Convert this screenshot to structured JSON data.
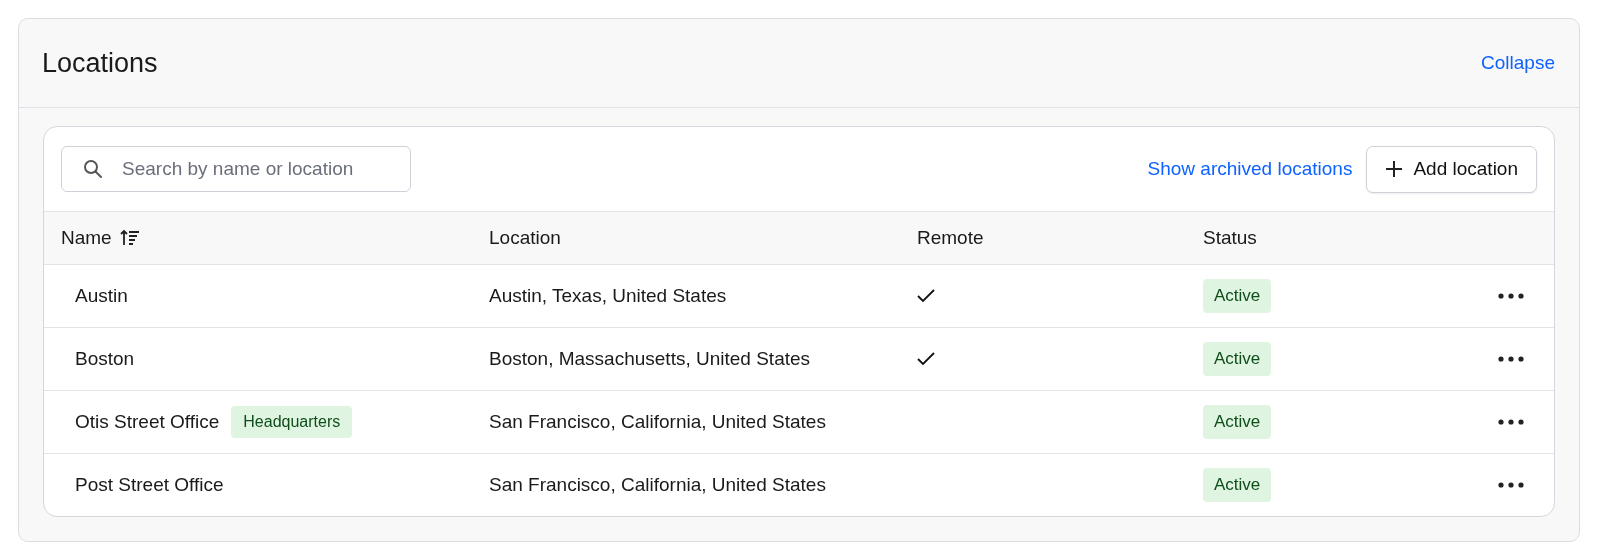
{
  "panel": {
    "title": "Locations",
    "collapse_link": "Collapse"
  },
  "toolbar": {
    "search": {
      "placeholder": "Search by name or location"
    },
    "archived_link": "Show archived locations",
    "add_button": "Add location"
  },
  "table": {
    "columns": [
      "Name",
      "Location",
      "Remote",
      "Status"
    ],
    "rows": [
      {
        "name": "Austin",
        "location": "Austin, Texas, United States",
        "remote": true,
        "status": "Active"
      },
      {
        "name": "Boston",
        "location": "Boston, Massachusetts, United States",
        "remote": true,
        "status": "Active"
      },
      {
        "name": "Otis Street Office",
        "tag": "Headquarters",
        "location": "San Francisco, California, United States",
        "remote": false,
        "status": "Active"
      },
      {
        "name": "Post Street Office",
        "location": "San Francisco, California, United States",
        "remote": false,
        "status": "Active"
      }
    ]
  }
}
